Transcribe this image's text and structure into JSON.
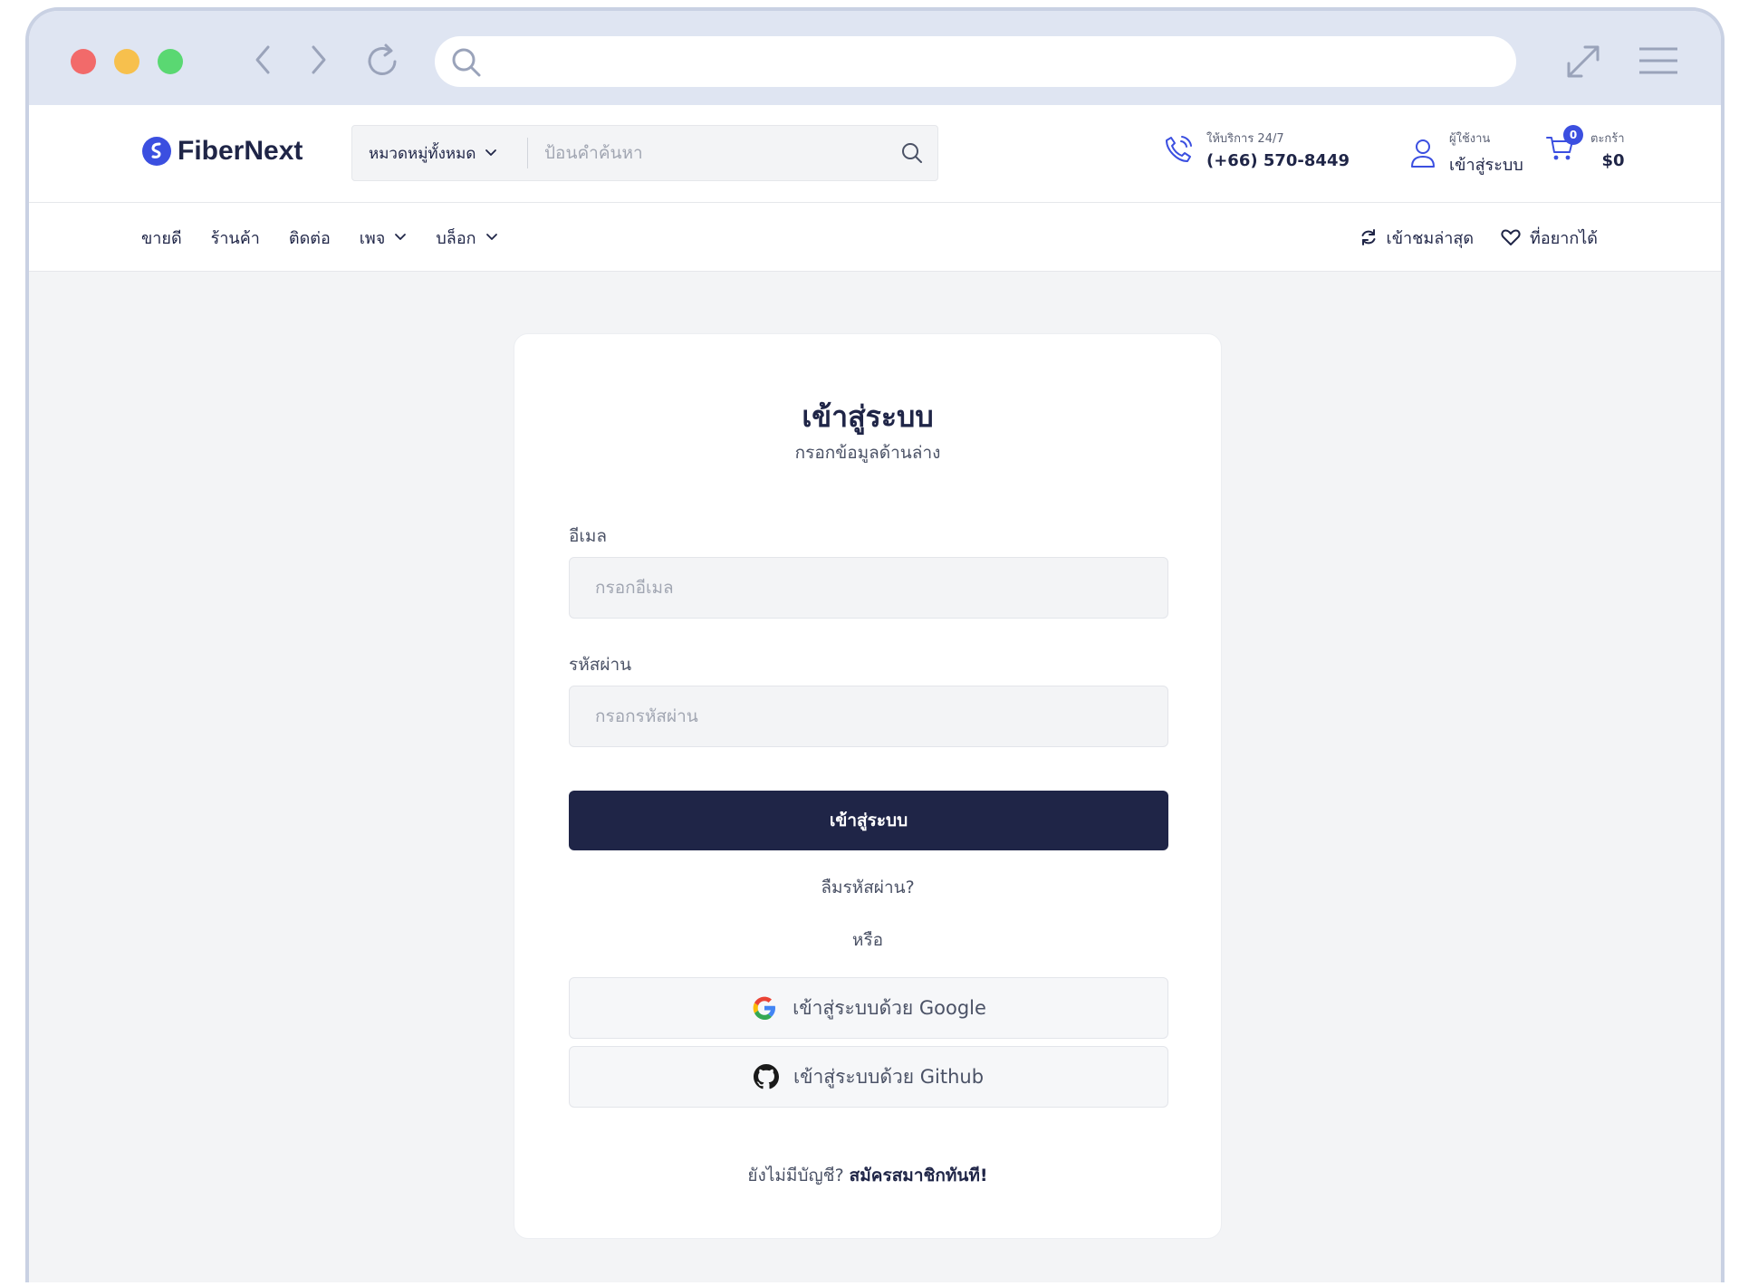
{
  "header": {
    "logo_text": "FiberNext",
    "search": {
      "category_label": "หมวดหมู่ทั้งหมด",
      "placeholder": "ป้อนคำค้นหา"
    },
    "support": {
      "label": "ให้บริการ 24/7",
      "phone": "(+66) 570-8449"
    },
    "account": {
      "label": "ผู้ใช้งาน",
      "value": "เข้าสู่ระบบ"
    },
    "cart": {
      "label": "ตะกร้า",
      "total": "$0",
      "count": "0"
    }
  },
  "nav": {
    "items": [
      {
        "label": "ขายดี",
        "has_dropdown": false
      },
      {
        "label": "ร้านค้า",
        "has_dropdown": false
      },
      {
        "label": "ติดต่อ",
        "has_dropdown": false
      },
      {
        "label": "เพจ",
        "has_dropdown": true
      },
      {
        "label": "บล็อก",
        "has_dropdown": true
      }
    ],
    "recent_label": "เข้าชมล่าสุด",
    "wishlist_label": "ที่อยากได้"
  },
  "login": {
    "title": "เข้าสู่ระบบ",
    "subtitle": "กรอกข้อมูลด้านล่าง",
    "email_label": "อีเมล",
    "email_placeholder": "กรอกอีเมล",
    "email_value": "",
    "password_label": "รหัสผ่าน",
    "password_placeholder": "กรอกรหัสผ่าน",
    "password_value": "",
    "submit_label": "เข้าสู่ระบบ",
    "forgot_label": "ลืมรหัสผ่าน?",
    "or_label": "หรือ",
    "google_label": "เข้าสู่ระบบด้วย Google",
    "github_label": "เข้าสู่ระบบด้วย Github",
    "no_account_label": "ยังไม่มีบัญชี?",
    "signup_label": "สมัครสมาชิกทันที!"
  },
  "colors": {
    "primary": "#1f2547",
    "accent": "#3b4fe0",
    "background": "#f3f4f6"
  },
  "icons": {
    "window_controls": [
      "close-dot",
      "minimize-dot",
      "maximize-dot"
    ],
    "browser": [
      "back-icon",
      "forward-icon",
      "reload-icon",
      "search-icon",
      "expand-icon",
      "menu-icon"
    ],
    "header": [
      "logo-icon",
      "chevron-down-icon",
      "search-icon",
      "phone-icon",
      "user-icon",
      "cart-icon"
    ],
    "nav": [
      "chevron-down-icon",
      "refresh-icon",
      "heart-icon"
    ],
    "social": [
      "google-icon",
      "github-icon"
    ]
  }
}
